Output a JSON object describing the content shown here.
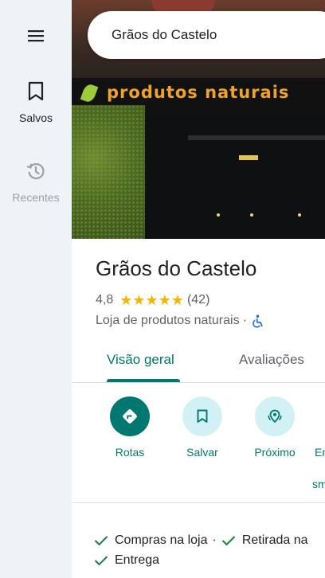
{
  "search": {
    "value": "Grãos do Castelo"
  },
  "sidebar": {
    "items": [
      {
        "label": "Salvos",
        "icon": "bookmark-icon"
      },
      {
        "label": "Recentes",
        "icon": "history-icon"
      }
    ]
  },
  "hero": {
    "sign_text": "produtos naturais"
  },
  "place": {
    "name": "Grãos do Castelo",
    "rating": "4,8",
    "stars": "★★★★★",
    "review_count": "(42)",
    "category": "Loja de produtos naturais",
    "separator": "·"
  },
  "tabs": [
    {
      "label": "Visão geral",
      "active": true
    },
    {
      "label": "Avaliações",
      "active": false
    }
  ],
  "actions": [
    {
      "label": "Rotas",
      "icon": "directions-icon"
    },
    {
      "label": "Salvar",
      "icon": "bookmark-icon"
    },
    {
      "label": "Próximo",
      "icon": "nearby-icon"
    },
    {
      "label": "En",
      "icon": ""
    },
    {
      "label": "sm",
      "icon": ""
    }
  ],
  "services": {
    "row1_a": "Compras na loja",
    "row1_sep": "·",
    "row1_b": "Retirada na",
    "row2_a": "Entrega"
  },
  "colors": {
    "accent": "#00786f",
    "rail_bg": "#eef3f6",
    "star": "#f6b400",
    "action_bg": "#d2f1f4",
    "check": "#188038"
  }
}
